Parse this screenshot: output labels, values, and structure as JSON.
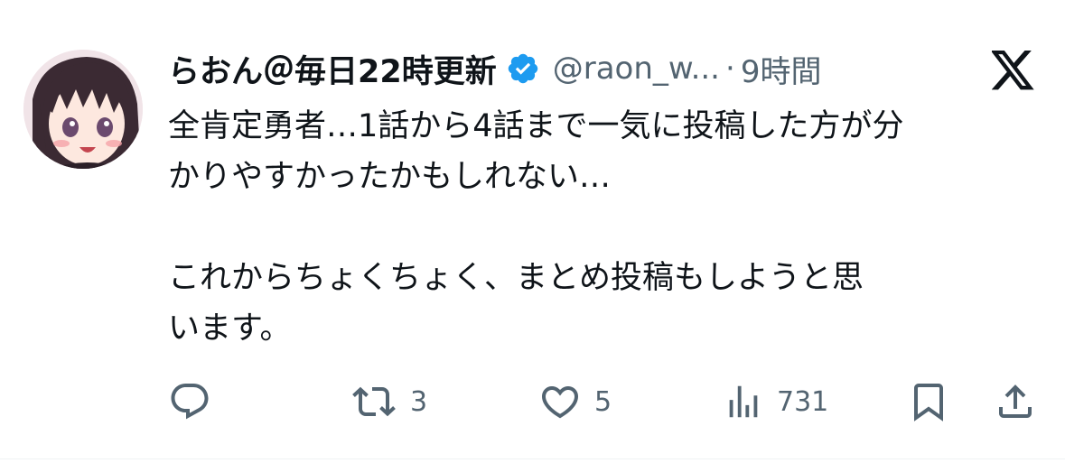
{
  "tweet": {
    "display_name": "らおん＠毎日22時更新",
    "handle": "@raon_w...",
    "separator": "·",
    "time": "9時間",
    "text_lines_1": [
      "全肯定勇者…1話から4話まで一気に投稿した方が分",
      "かりやすかったかもしれない…"
    ],
    "text_lines_2": [
      "これからちょくちょく、まとめ投稿もしようと思",
      "います。"
    ],
    "platform_icon": "x-logo-icon",
    "verified_icon": "verified-badge-icon",
    "verified_color": "#1d9bf0"
  },
  "actions": {
    "reply_count": "",
    "retweet_count": "3",
    "like_count": "5",
    "views_count": "731",
    "icon_color": "#536471"
  }
}
